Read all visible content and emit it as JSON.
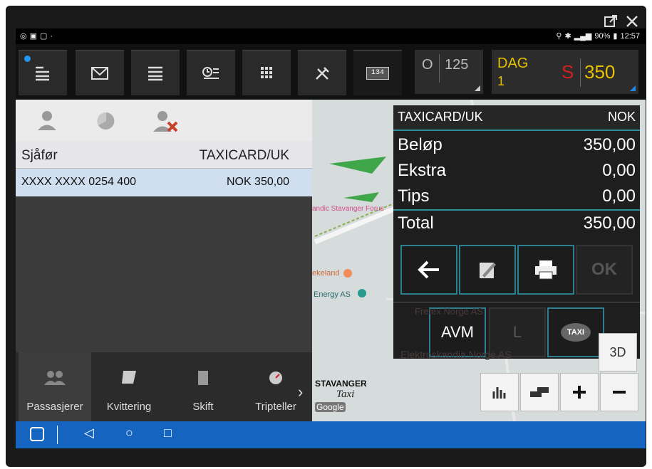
{
  "window": {
    "actions": [
      "open-external-icon",
      "close-icon"
    ]
  },
  "statusbar": {
    "right_text": "90%",
    "clock": "12:57"
  },
  "toolbar": {
    "counter_prefix": "O",
    "counter_value": "125",
    "badge_134": "134",
    "day_label": "DAG",
    "day_number": "1",
    "amount_prefix": "S",
    "amount_value": "350"
  },
  "left": {
    "row_title_left": "Sjåfør",
    "row_title_right": "TAXICARD/UK",
    "row_value_left": "XXXX XXXX 0254 400",
    "row_value_right": "NOK 350,00",
    "tabs": [
      {
        "label": "Passasjerer"
      },
      {
        "label": "Kvittering"
      },
      {
        "label": "Skift"
      },
      {
        "label": "Tripteller"
      }
    ]
  },
  "map": {
    "label_stavanger_forus": "andic Stavanger Forus",
    "label_rekeland": "ekeland",
    "label_energy": "Energy AS",
    "label_fretex": "Fretex Norge AS",
    "label_elektro": "Elektroskandia Norge AS",
    "label_3d": "3D",
    "label_google": "Google",
    "logo_top": "STAVANGER",
    "logo_bottom": "Taxi"
  },
  "payment": {
    "header_left": "TAXICARD/UK",
    "header_right": "NOK",
    "lines": [
      {
        "label": "Beløp",
        "value": "350,00"
      },
      {
        "label": "Ekstra",
        "value": "0,00"
      },
      {
        "label": "Tips",
        "value": "0,00"
      },
      {
        "label": "Total",
        "value": "350,00"
      }
    ],
    "ok_label": "OK",
    "avm_label": "AVM",
    "l_label": "L",
    "taxi_label": "TAXI"
  },
  "colors": {
    "accent": "#2b7f8e",
    "yellow": "#e8c100",
    "red": "#d32020",
    "navbar": "#1565c0"
  }
}
